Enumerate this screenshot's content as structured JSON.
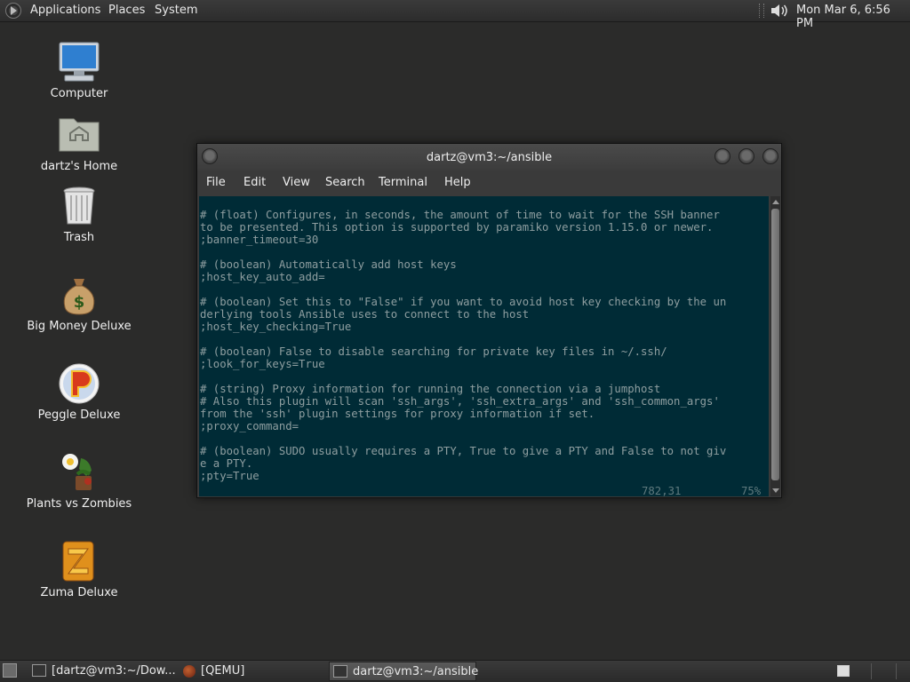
{
  "top_panel": {
    "menus": [
      "Applications",
      "Places",
      "System"
    ],
    "clock": "Mon Mar  6,  6:56 PM"
  },
  "desktop_icons": [
    {
      "label": "Computer",
      "icon": "computer-icon"
    },
    {
      "label": "dartz's Home",
      "icon": "home-folder-icon"
    },
    {
      "label": "Trash",
      "icon": "trash-icon"
    },
    {
      "label": "Big Money Deluxe",
      "icon": "money-bag-icon"
    },
    {
      "label": "Peggle Deluxe",
      "icon": "peggle-icon"
    },
    {
      "label": "Plants vs Zombies",
      "icon": "plants-vs-zombies-icon"
    },
    {
      "label": "Zuma Deluxe",
      "icon": "zuma-icon"
    }
  ],
  "terminal": {
    "title": "dartz@vm3:~/ansible",
    "menus": [
      "File",
      "Edit",
      "View",
      "Search",
      "Terminal",
      "Help"
    ],
    "content": "# (float) Configures, in seconds, the amount of time to wait for the SSH banner\nto be presented. This option is supported by paramiko version 1.15.0 or newer.\n;banner_timeout=30\n\n# (boolean) Automatically add host keys\n;host_key_auto_add=\n\n# (boolean) Set this to \"False\" if you want to avoid host key checking by the un\nderlying tools Ansible uses to connect to the host\n;host_key_checking=True\n\n# (boolean) False to disable searching for private key files in ~/.ssh/\n;look_for_keys=True\n\n# (string) Proxy information for running the connection via a jumphost\n# Also this plugin will scan 'ssh_args', 'ssh_extra_args' and 'ssh_common_args'\nfrom the 'ssh' plugin settings for proxy information if set.\n;proxy_command=\n\n# (boolean) SUDO usually requires a PTY, True to give a PTY and False to not giv\ne a PTY.\n;pty=True",
    "status_position": "782,31",
    "status_percent": "75%",
    "background_color": "#002b36"
  },
  "taskbar": {
    "tasks": [
      {
        "label": "[dartz@vm3:~/Dow...",
        "icon": "terminal-icon",
        "active": false
      },
      {
        "label": "[QEMU]",
        "icon": "qemu-icon",
        "active": false
      },
      {
        "label": "dartz@vm3:~/ansible",
        "icon": "terminal-icon",
        "active": true
      }
    ]
  }
}
